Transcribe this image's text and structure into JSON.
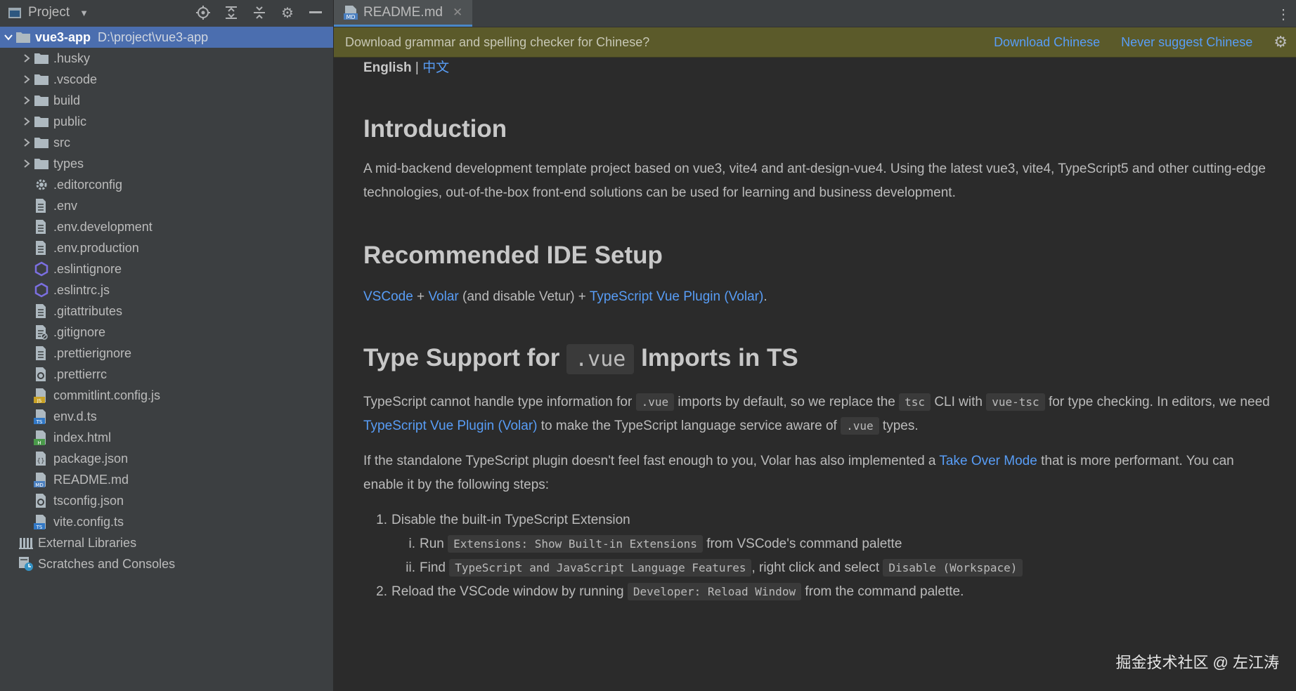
{
  "project_panel": {
    "title": "Project",
    "root": {
      "name": "vue3-app",
      "path": "D:\\project\\vue3-app"
    },
    "folders": [
      ".husky",
      ".vscode",
      "build",
      "public",
      "src",
      "types"
    ],
    "files": [
      {
        "name": ".editorconfig",
        "icon": "gear-file-icon"
      },
      {
        "name": ".env",
        "icon": "text-file-icon"
      },
      {
        "name": ".env.development",
        "icon": "text-file-icon"
      },
      {
        "name": ".env.production",
        "icon": "text-file-icon"
      },
      {
        "name": ".eslintignore",
        "icon": "eslint-icon"
      },
      {
        "name": ".eslintrc.js",
        "icon": "eslint-icon"
      },
      {
        "name": ".gitattributes",
        "icon": "text-file-icon"
      },
      {
        "name": ".gitignore",
        "icon": "ignore-file-icon"
      },
      {
        "name": ".prettierignore",
        "icon": "text-file-icon"
      },
      {
        "name": ".prettierrc",
        "icon": "config-file-icon"
      },
      {
        "name": "commitlint.config.js",
        "icon": "js-file-icon"
      },
      {
        "name": "env.d.ts",
        "icon": "ts-file-icon"
      },
      {
        "name": "index.html",
        "icon": "html-file-icon"
      },
      {
        "name": "package.json",
        "icon": "json-file-icon"
      },
      {
        "name": "README.md",
        "icon": "md-file-icon"
      },
      {
        "name": "tsconfig.json",
        "icon": "config-file-icon"
      },
      {
        "name": "vite.config.ts",
        "icon": "ts-file-icon"
      }
    ],
    "extra": [
      "External Libraries",
      "Scratches and Consoles"
    ]
  },
  "tab": {
    "label": "README.md",
    "close": "✕"
  },
  "notification": {
    "text": "Download grammar and spelling checker for Chinese?",
    "download": "Download Chinese",
    "never": "Never suggest Chinese"
  },
  "readme": {
    "lang_en": "English",
    "lang_sep": "|",
    "lang_zh": "中文",
    "intro_title": "Introduction",
    "intro_text": "A mid-backend development template project based on vue3, vite4 and ant-design-vue4. Using the latest vue3, vite4, TypeScript5 and other cutting-edge technologies, out-of-the-box front-end solutions can be used for learning and business development.",
    "ide_title": "Recommended IDE Setup",
    "ide": {
      "vscode": "VSCode",
      "plus1": " + ",
      "volar": "Volar",
      "mid": " (and disable Vetur) + ",
      "plugin": "TypeScript Vue Plugin (Volar)",
      "end": "."
    },
    "type_title_a": "Type Support for",
    "type_title_code": ".vue",
    "type_title_b": "Imports in TS",
    "p1": {
      "a": "TypeScript cannot handle type information for ",
      "c1": ".vue",
      "b": " imports by default, so we replace the ",
      "c2": "tsc",
      "c": " CLI with ",
      "c3": "vue-tsc",
      "d": " for type checking. In editors, we need ",
      "link": "TypeScript Vue Plugin (Volar)",
      "e": " to make the TypeScript language service aware of ",
      "c4": ".vue",
      "f": " types."
    },
    "p2": {
      "a": "If the standalone TypeScript plugin doesn't feel fast enough to you, Volar has also implemented a ",
      "link": "Take Over Mode",
      "b": " that is more performant. You can enable it by the following steps:"
    },
    "steps": {
      "n1": "1.",
      "s1": "Disable the built-in TypeScript Extension",
      "ni": "i.",
      "si_a": "Run ",
      "si_code": "Extensions: Show Built-in Extensions",
      "si_b": " from VSCode's command palette",
      "nii": "ii.",
      "sii_a": "Find ",
      "sii_code": "TypeScript and JavaScript Language Features",
      "sii_b": ", right click and select ",
      "sii_code2": "Disable (Workspace)",
      "n2": "2.",
      "s2_a": "Reload the VSCode window by running ",
      "s2_code": "Developer: Reload Window",
      "s2_b": " from the command palette."
    }
  },
  "watermark": "掘金技术社区 @ 左江涛"
}
